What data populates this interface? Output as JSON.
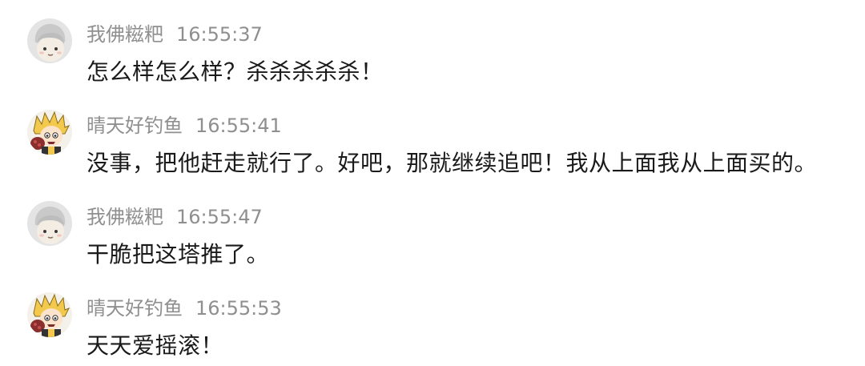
{
  "messages": [
    {
      "username": "我佛糍粑",
      "time": "16:55:37",
      "text": "怎么样怎么样？杀杀杀杀杀！",
      "avatar_icon": "ghost-doll-avatar-icon"
    },
    {
      "username": "晴天好钓鱼",
      "time": "16:55:41",
      "text": "没事，把他赶走就行了。好吧，那就继续追吧！我从上面我从上面买的。",
      "avatar_icon": "cartoon-boy-avatar-icon"
    },
    {
      "username": "我佛糍粑",
      "time": "16:55:47",
      "text": "干脆把这塔推了。",
      "avatar_icon": "ghost-doll-avatar-icon"
    },
    {
      "username": "晴天好钓鱼",
      "time": "16:55:53",
      "text": "天天爱摇滚！",
      "avatar_icon": "cartoon-boy-avatar-icon"
    }
  ],
  "colors": {
    "username": "#8f8f8f",
    "text": "#1a1a1a",
    "background": "#ffffff"
  }
}
